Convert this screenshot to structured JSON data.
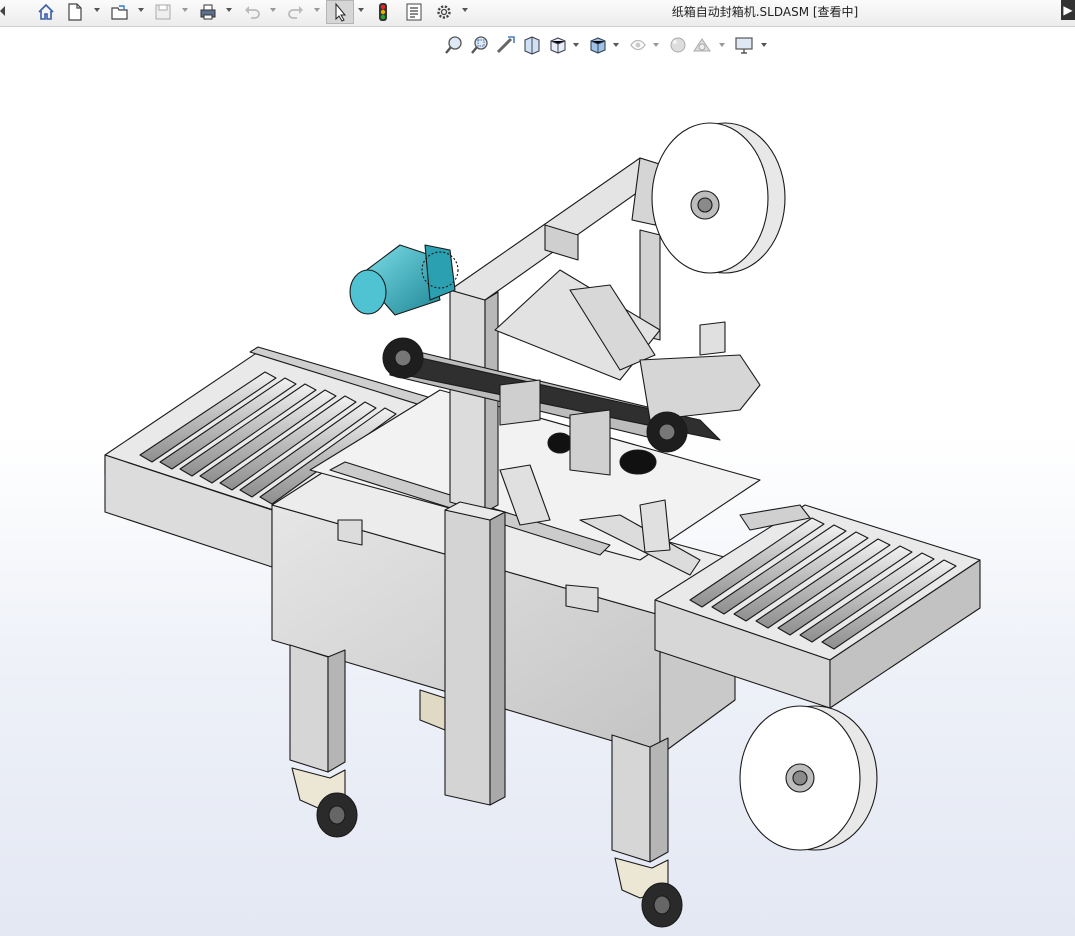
{
  "window": {
    "title": "纸箱自动封箱机.SLDASM [查看中]"
  },
  "toolbar": {
    "buttons": [
      {
        "name": "home",
        "icon": "home-icon"
      },
      {
        "name": "new",
        "icon": "new-document-icon"
      },
      {
        "name": "open",
        "icon": "open-folder-icon"
      },
      {
        "name": "save",
        "icon": "save-icon",
        "enabled": false
      },
      {
        "name": "print",
        "icon": "printer-icon"
      },
      {
        "name": "undo",
        "icon": "undo-icon",
        "enabled": false
      },
      {
        "name": "redo",
        "icon": "redo-icon",
        "enabled": false
      },
      {
        "name": "select",
        "icon": "cursor-icon",
        "active": true
      },
      {
        "name": "rebuild",
        "icon": "traffic-light-icon"
      },
      {
        "name": "file-properties",
        "icon": "properties-icon"
      },
      {
        "name": "options",
        "icon": "gear-icon"
      }
    ]
  },
  "heads_up_toolbar": {
    "buttons": [
      "zoom-to-fit-icon",
      "zoom-to-area-icon",
      "previous-view-icon",
      "section-view-icon",
      "view-orientation-icon",
      "display-style-icon",
      "hide-show-items-icon",
      "edit-appearance-icon",
      "apply-scene-icon",
      "view-settings-icon"
    ]
  },
  "colors": {
    "frame": "#d9d9d9",
    "frame_dark": "#a8a8a8",
    "motor": "#3fb8c8",
    "outline": "#1a1a1a",
    "background_bottom": "#e4e8f3"
  }
}
